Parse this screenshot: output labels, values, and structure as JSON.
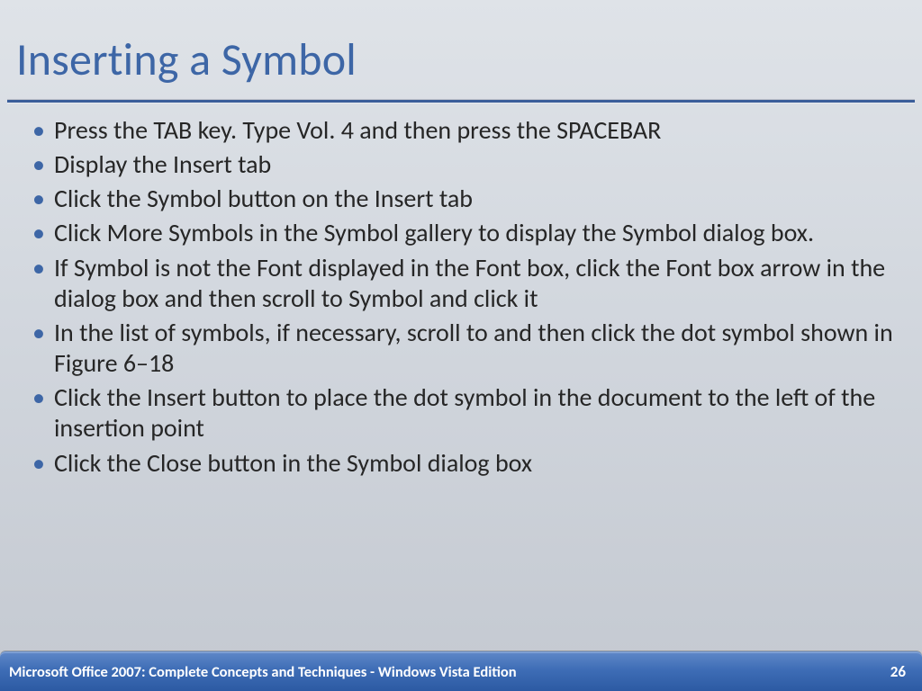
{
  "title": "Inserting a Symbol",
  "bullets": [
    "Press the TAB key. Type Vol. 4 and then press the SPACEBAR",
    "Display the Insert tab",
    "Click the Symbol button on the Insert tab",
    "Click More Symbols in the Symbol gallery to display the Symbol dialog box.",
    "If Symbol is not the Font displayed in the Font box, click the Font box arrow in the dialog box and then scroll to Symbol and click it",
    "In the list of symbols, if necessary, scroll to and then click the dot symbol shown in Figure 6–18",
    "Click the Insert button to place the dot symbol in the document to the left of the insertion point",
    "Click the Close button in the Symbol dialog box"
  ],
  "footer": {
    "left": "Microsoft Office 2007: Complete Concepts and Techniques - Windows Vista Edition",
    "page": "26"
  }
}
